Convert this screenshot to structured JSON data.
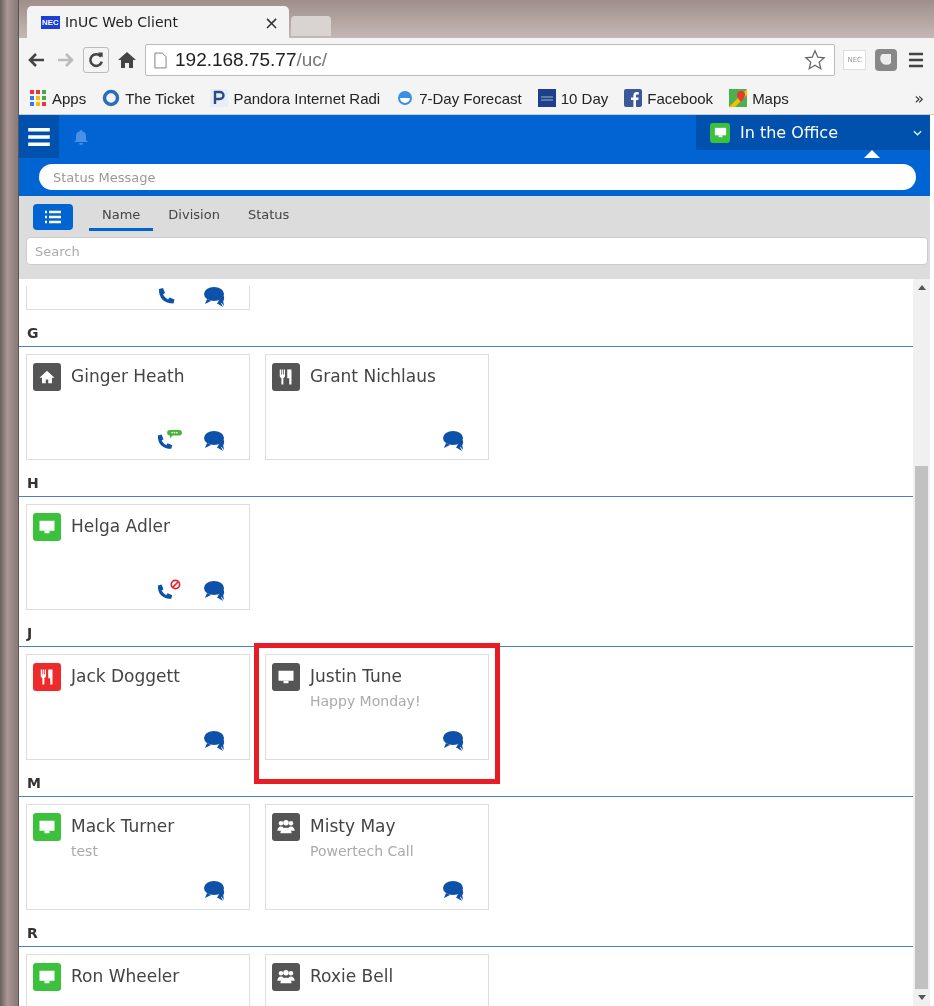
{
  "browser": {
    "tab_title": "InUC Web Client",
    "tab_close": "×",
    "url_host": "192.168.75.77",
    "url_path": "/uc/",
    "nec_label": "NEC",
    "extension_label": "NEC",
    "bookmarks": [
      {
        "kind": "apps",
        "label": "Apps"
      },
      {
        "kind": "globe",
        "label": "The Ticket"
      },
      {
        "kind": "pandora",
        "label": "Pandora Internet Radi"
      },
      {
        "kind": "weather",
        "label": "7-Day Forecast"
      },
      {
        "kind": "channel",
        "label": "10 Day"
      },
      {
        "kind": "facebook",
        "label": "Facebook"
      },
      {
        "kind": "maps",
        "label": "Maps"
      }
    ],
    "bookmarks_more": "»"
  },
  "header": {
    "presence": {
      "label": "In the Office",
      "kind": "monitor",
      "color": "#3cc13c"
    }
  },
  "status_message": {
    "placeholder": "Status Message"
  },
  "sort_tabs": [
    {
      "label": "Name",
      "selected": true
    },
    {
      "label": "Division",
      "selected": false
    },
    {
      "label": "Status",
      "selected": false
    }
  ],
  "search": {
    "placeholder": "Search"
  },
  "groups": [
    {
      "contacts": [
        {
          "actions": [
            {
              "kind": "phone"
            },
            {
              "kind": "chat"
            }
          ]
        }
      ]
    },
    {
      "letter": "G",
      "contacts": [
        {
          "name": "Ginger Heath",
          "kind": "home",
          "color": "#555555",
          "actions": [
            {
              "kind": "phone-chat"
            },
            {
              "kind": "chat"
            }
          ]
        },
        {
          "name": "Grant Nichlaus",
          "kind": "food",
          "color": "#555555",
          "actions": [
            {
              "kind": "chat"
            }
          ]
        }
      ]
    },
    {
      "letter": "H",
      "contacts": [
        {
          "name": "Helga Adler",
          "kind": "monitor",
          "color": "#3cc13c",
          "actions": [
            {
              "kind": "phone-blocked"
            },
            {
              "kind": "chat"
            }
          ]
        }
      ]
    },
    {
      "letter": "J",
      "contacts": [
        {
          "name": "Jack Doggett",
          "kind": "food",
          "color": "#ee2b2b",
          "actions": [
            {
              "kind": "chat"
            }
          ]
        },
        {
          "name": "Justin Tune",
          "message": "Happy Monday!",
          "kind": "monitor",
          "color": "#555555",
          "highlighted": true,
          "actions": [
            {
              "kind": "chat"
            }
          ]
        }
      ]
    },
    {
      "letter": "M",
      "contacts": [
        {
          "name": "Mack Turner",
          "message": "test",
          "kind": "monitor",
          "color": "#3cc13c",
          "actions": [
            {
              "kind": "chat"
            }
          ]
        },
        {
          "name": "Misty May",
          "message": "Powertech Call",
          "kind": "group",
          "color": "#555555",
          "actions": [
            {
              "kind": "chat"
            }
          ]
        }
      ]
    },
    {
      "letter": "R",
      "contacts": [
        {
          "name": "Ron Wheeler",
          "kind": "monitor",
          "color": "#3cc13c"
        },
        {
          "name": "Roxie Bell",
          "kind": "group",
          "color": "#555555"
        }
      ]
    }
  ]
}
